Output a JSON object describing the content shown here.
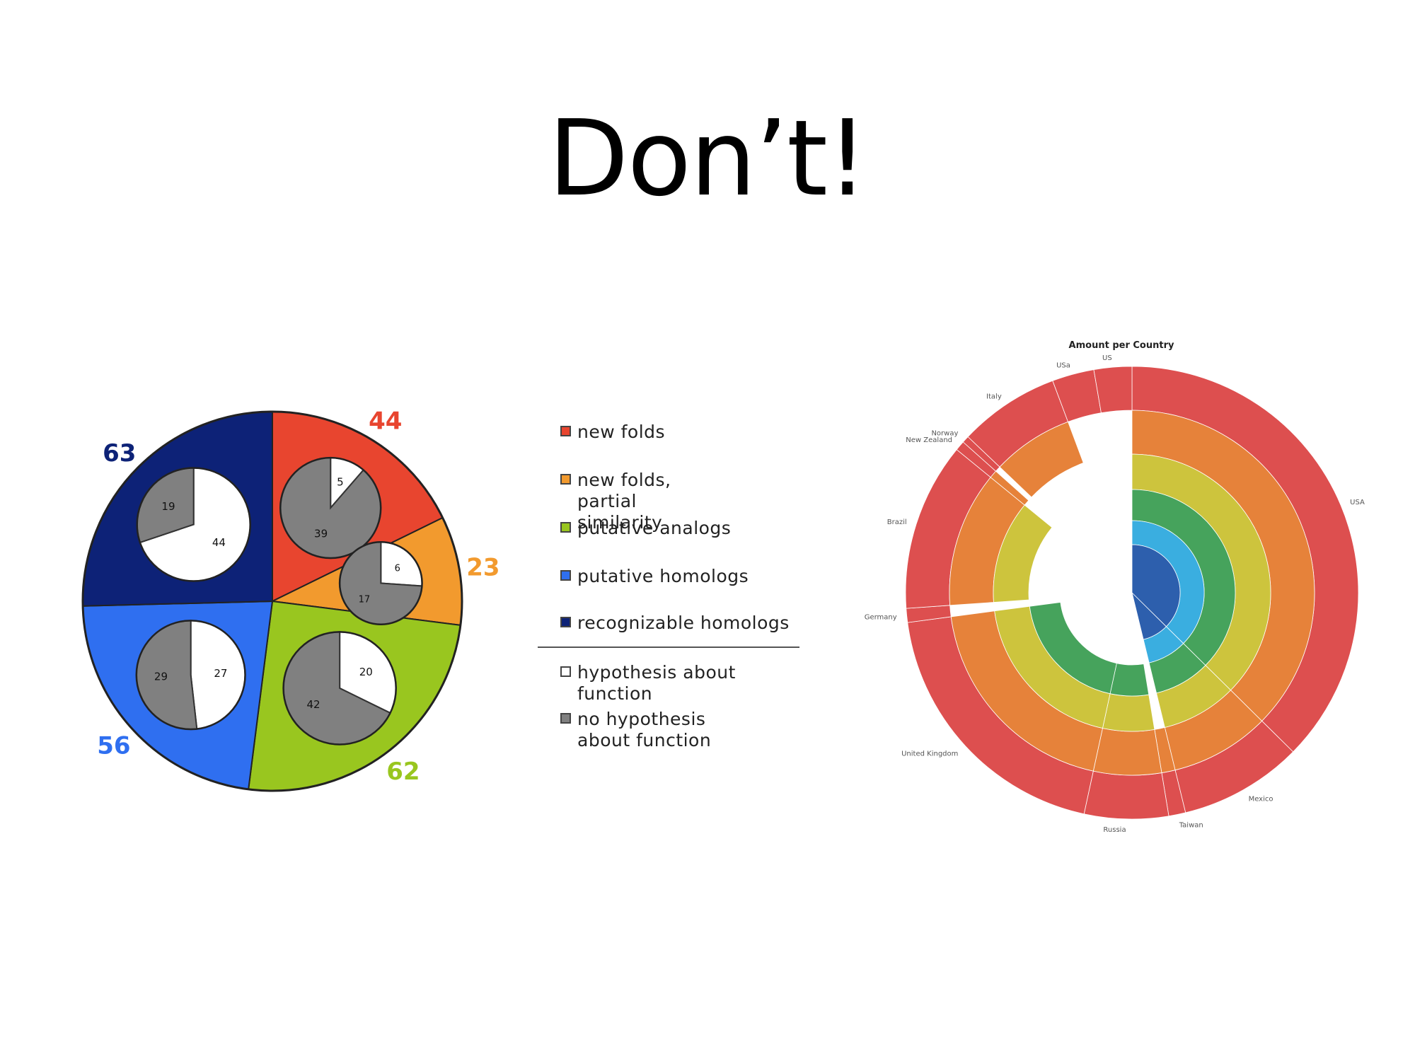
{
  "slide": {
    "title": "Don’t!"
  },
  "colors": {
    "new_folds": "#e8452f",
    "partial_similarity": "#f29a2e",
    "putative_analogs": "#99c61f",
    "putative_homologs": "#2f6ff0",
    "recognizable_homologs": "#0d2277",
    "hypothesis": "#ffffff",
    "no_hypothesis": "#808080",
    "sun_red": "#dd4f4f",
    "sun_orange": "#e6823a",
    "sun_yellow": "#cdc43d",
    "sun_green": "#46a35c",
    "sun_lightblue": "#3aaee0",
    "sun_blue": "#2d5fad"
  },
  "chart_data": [
    {
      "type": "pie",
      "title": "",
      "slices": [
        {
          "label": "new folds",
          "value": 44,
          "color": "#e8452f",
          "label_color": "#e8452f",
          "subpie": {
            "hypothesis": 5,
            "no_hypothesis": 39
          }
        },
        {
          "label": "new folds, partial similarity",
          "value": 23,
          "color": "#f29a2e",
          "label_color": "#f29a2e",
          "subpie": {
            "hypothesis": 6,
            "no_hypothesis": 17
          }
        },
        {
          "label": "putative analogs",
          "value": 62,
          "color": "#99c61f",
          "label_color": "#99c61f",
          "subpie": {
            "hypothesis": 20,
            "no_hypothesis": 42
          }
        },
        {
          "label": "putative homologs",
          "value": 56,
          "color": "#2f6ff0",
          "label_color": "#2f6ff0",
          "subpie": {
            "hypothesis": 27,
            "no_hypothesis": 29
          }
        },
        {
          "label": "recognizable homologs",
          "value": 63,
          "color": "#0d2277",
          "label_color": "#0d2277",
          "subpie": {
            "hypothesis": 44,
            "no_hypothesis": 19
          }
        }
      ],
      "legend": {
        "items": [
          {
            "label": "new folds",
            "color": "#e8452f"
          },
          {
            "label": "new folds, partial similarity",
            "color": "#f29a2e"
          },
          {
            "label": "putative analogs",
            "color": "#99c61f"
          },
          {
            "label": "putative homologs",
            "color": "#2f6ff0"
          },
          {
            "label": "recognizable homologs",
            "color": "#0d2277"
          },
          {
            "label": "hypothesis about function",
            "color": "#ffffff"
          },
          {
            "label": "no hypothesis about function",
            "color": "#808080"
          }
        ],
        "placement": "right"
      }
    },
    {
      "type": "sunburst",
      "title": "Amount per Country",
      "legend": "none",
      "labels": [
        "USA",
        "Mexico",
        "Taiwan",
        "Russia",
        "United Kingdom",
        "Germany",
        "Brazil",
        "New Zealand",
        "Norway",
        "Italy",
        "USa",
        "US"
      ],
      "outer_segments": [
        {
          "label": "USA",
          "share": 0.374
        },
        {
          "label": "Mexico",
          "share": 0.088
        },
        {
          "label": "Taiwan",
          "share": 0.012
        },
        {
          "label": "Russia",
          "share": 0.06
        },
        {
          "label": "United Kingdom",
          "share": 0.195
        },
        {
          "label": "Germany",
          "share": 0.01
        },
        {
          "label": "Brazil",
          "share": 0.12
        },
        {
          "label": "New Zealand",
          "share": 0.007
        },
        {
          "label": "Norway",
          "share": 0.005
        },
        {
          "label": "Italy",
          "share": 0.072
        },
        {
          "label": "USa",
          "share": 0.03
        },
        {
          "label": "US",
          "share": 0.027
        }
      ]
    }
  ]
}
